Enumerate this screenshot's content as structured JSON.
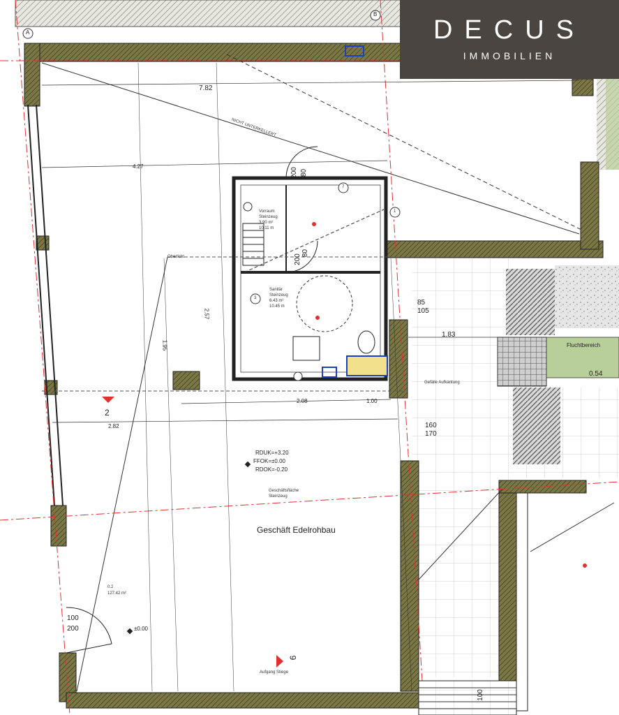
{
  "logo": {
    "brand": "DECUS",
    "subtitle": "IMMOBILIEN"
  },
  "room_main": {
    "name": "Geschäft Edelrohbau",
    "levels": [
      "RDUK=+3.20",
      "FFOK=±0.00",
      "RDOK=-0.20"
    ],
    "area_label": "0.2",
    "area_value": "127.42 m²",
    "floor_height": "±0.00"
  },
  "room_vorraum": {
    "name": "Vorraum",
    "floor": "Steinzeug",
    "area": "3.90 m²",
    "perimeter": "10.11 m"
  },
  "room_sanitaer": {
    "name": "Sanitär",
    "floor": "Steinzeug",
    "area": "6.43 m²",
    "perimeter": "10.45 m"
  },
  "fluchtbereich": "Fluchtbereich",
  "dimensions": {
    "top_width": "7.82",
    "d1_83": "1.83",
    "d0_54": "0.54",
    "door_main_a": "100",
    "door_main_b": "200",
    "door_inner_a": "80",
    "door_inner_b": "200",
    "door_wc": "80",
    "door_wc_h": "200",
    "d85": "85",
    "d105": "105",
    "d160": "160",
    "d170": "170",
    "d100_bottom": "100",
    "d2_08": "2.08",
    "d1_00": "1.00",
    "d2_82": "2.82",
    "d4_27": "4.27",
    "d1_95": "1.95",
    "d2_57": "2.57"
  },
  "markers": {
    "section_2": "2",
    "section_9": "9",
    "axis_a": "A",
    "axis_b": "B",
    "circle_1": "1",
    "circle_3": "3",
    "circle_7": "7"
  },
  "annotations": {
    "nicht_unterkellert": "NICHT UNTERKELLERT",
    "geschaeftsflaeche": "Geschäftsfläche",
    "belag": "Steinzeug",
    "aufgang": "Aufgang Stiege",
    "bodenaufbau": "Gefälle Aufkantung",
    "oberlicht": "Oberlicht"
  },
  "colors": {
    "wall_fill": "#6b6a3e",
    "logo_bg": "#4a4541",
    "red_line": "#e03030",
    "green_fill": "#b9cf9a"
  }
}
